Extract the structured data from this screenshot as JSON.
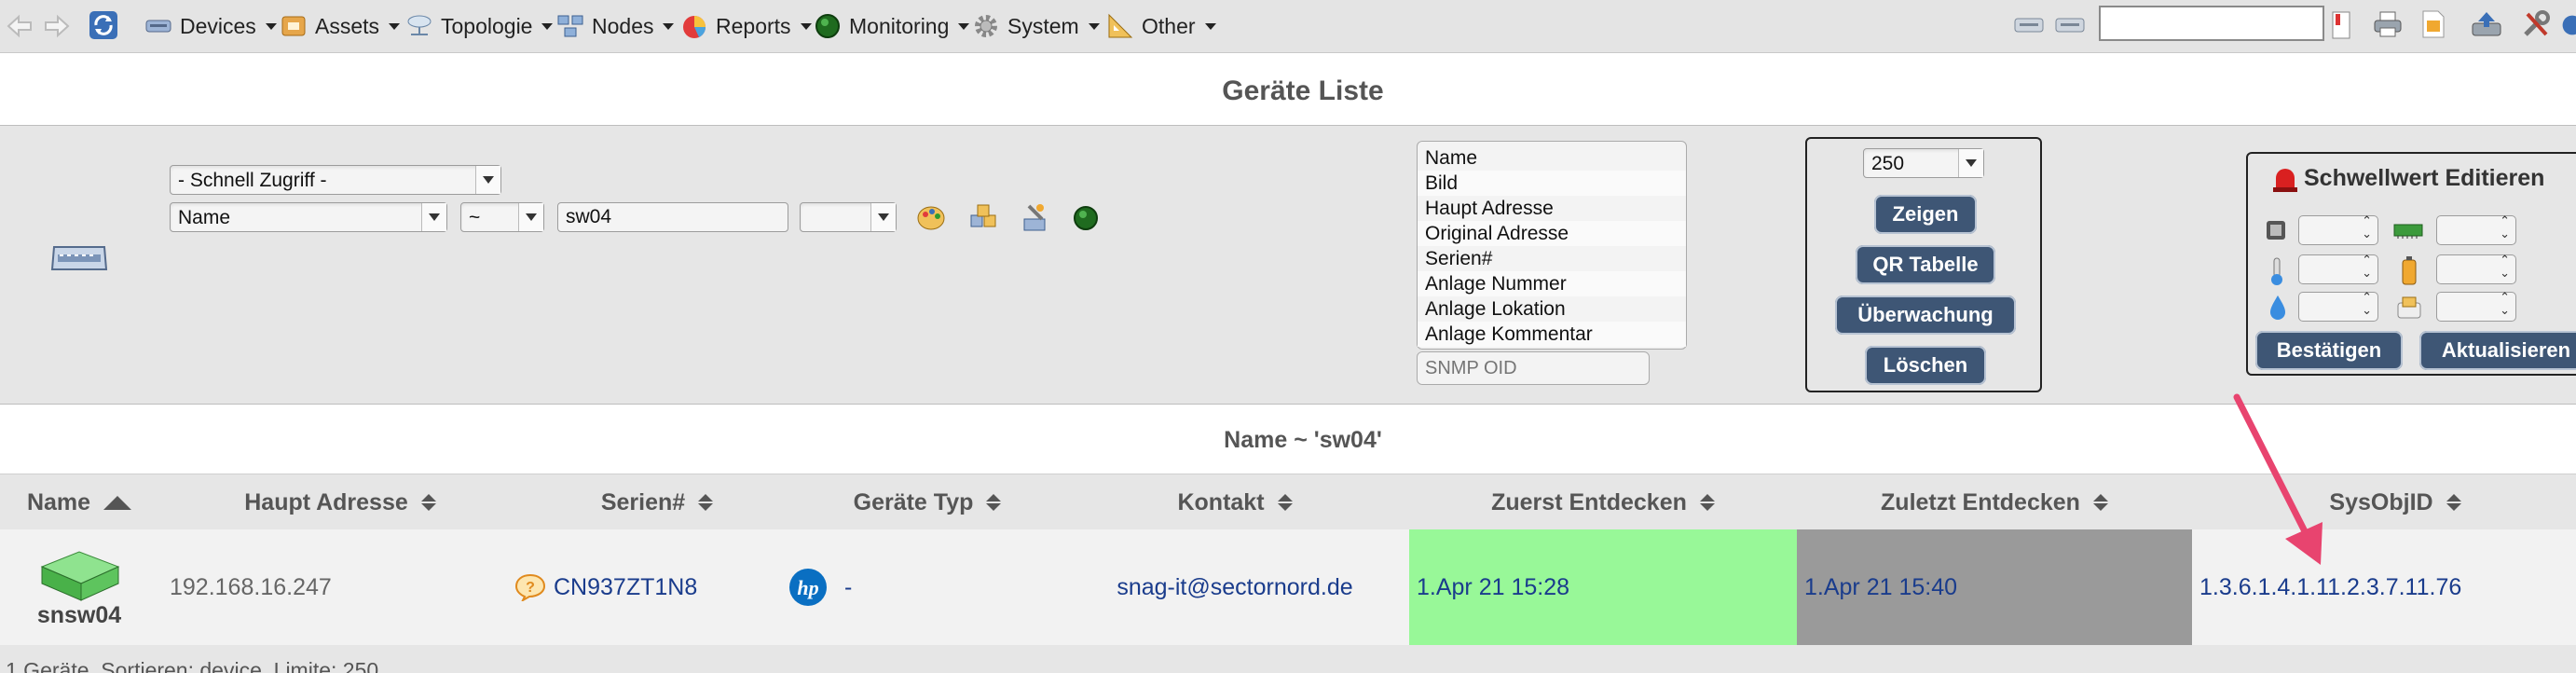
{
  "nav": {
    "menus": [
      {
        "label": "Devices",
        "icon": "devices-icon"
      },
      {
        "label": "Assets",
        "icon": "assets-icon"
      },
      {
        "label": "Topologie",
        "icon": "topology-icon"
      },
      {
        "label": "Nodes",
        "icon": "nodes-icon"
      },
      {
        "label": "Reports",
        "icon": "reports-icon"
      },
      {
        "label": "Monitoring",
        "icon": "monitoring-icon"
      },
      {
        "label": "System",
        "icon": "gear-icon"
      },
      {
        "label": "Other",
        "icon": "ruler-icon"
      }
    ],
    "search_value": ""
  },
  "page_title": "Geräte Liste",
  "filter": {
    "quick_access": "- Schnell Zugriff -",
    "field": "Name",
    "operator": "~",
    "value": "sw04",
    "extra_select": ""
  },
  "columns": [
    "Name",
    "Bild",
    "Haupt Adresse",
    "Original Adresse",
    "Serien#",
    "Anlage Nummer",
    "Anlage Lokation",
    "Anlage Kommentar"
  ],
  "snmp_oid_placeholder": "SNMP OID",
  "actions": {
    "limit": "250",
    "show": "Zeigen",
    "qr": "QR Tabelle",
    "monitoring": "Überwachung",
    "delete": "Löschen"
  },
  "threshold": {
    "title": "Schwellwert Editieren",
    "confirm": "Bestätigen",
    "update": "Aktualisieren"
  },
  "query_caption": "Name ~ 'sw04'",
  "table": {
    "headers": [
      "Name",
      "Haupt Adresse",
      "Serien#",
      "Geräte Typ",
      "Kontakt",
      "Zuerst Entdecken",
      "Zuletzt Entdecken",
      "SysObjID"
    ],
    "row": {
      "name": "snsw04",
      "address": "192.168.16.247",
      "serial": "CN937ZT1N8",
      "type": "-",
      "contact": "snag-it@sectornord.de",
      "first_seen": "1.Apr 21 15:28",
      "last_seen": "1.Apr 21 15:40",
      "sysobjid": "1.3.6.1.4.1.11.2.3.7.11.76"
    }
  },
  "footer": "1 Geräte, Sortieren: device, Limite: 250",
  "colors": {
    "first_seen_bg": "#98f898",
    "last_seen_bg": "#9a9a9a",
    "button": "#3e5675",
    "arrow": "#e8446f"
  }
}
